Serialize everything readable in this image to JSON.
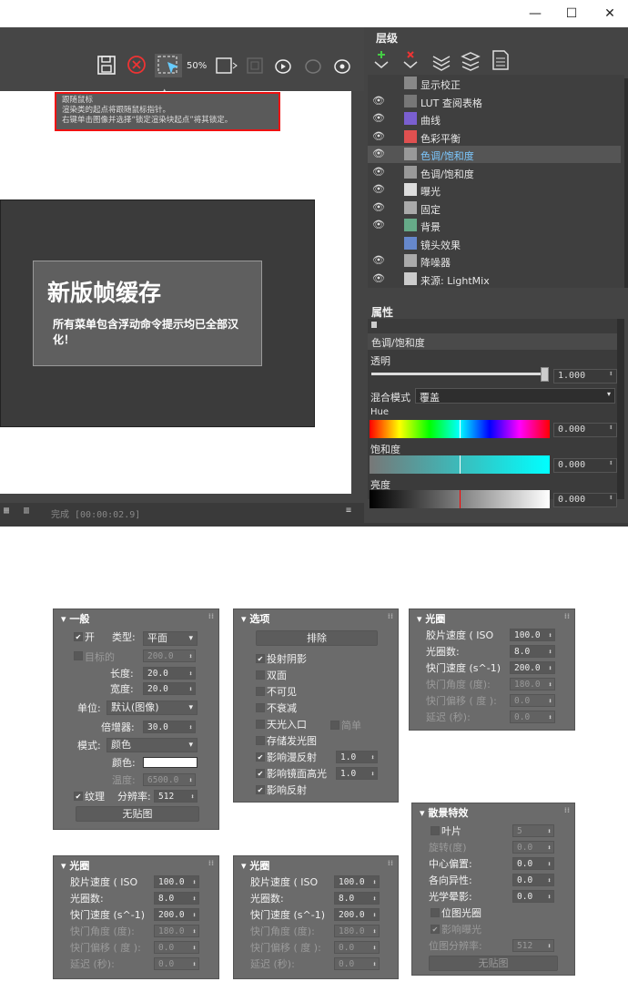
{
  "window": {
    "minimize": "—",
    "maximize": "☐",
    "close": "✕"
  },
  "viewer": {
    "zoom_label": "50%",
    "tooltip": {
      "line1": "跟随鼠标",
      "line2": "渲染类的起点将跟随鼠标指针。",
      "line3": "右键单击图像并选择“锁定渲染块起点”将其锁定。"
    },
    "card": {
      "title": "新版帧缓存",
      "desc": "所有菜单包含浮动命令提示均已全部汉化！"
    },
    "status": "完成 [00:00:02.9]"
  },
  "layers": {
    "title": "层级",
    "items": [
      {
        "label": "显示校正",
        "eye": false,
        "color": "#888"
      },
      {
        "label": "LUT 查阅表格",
        "eye": true,
        "color": "#777"
      },
      {
        "label": "曲线",
        "eye": true,
        "color": "#7a5fd0"
      },
      {
        "label": "色彩平衡",
        "eye": true,
        "color": "#e05050"
      },
      {
        "label": "色调/饱和度",
        "eye": true,
        "color": "#999",
        "selected": true
      },
      {
        "label": "色调/饱和度",
        "eye": true,
        "color": "#999"
      },
      {
        "label": "曝光",
        "eye": true,
        "color": "#ddd"
      },
      {
        "label": "固定",
        "eye": true,
        "color": "#aaa"
      },
      {
        "label": "背景",
        "eye": true,
        "color": "#6a8"
      },
      {
        "label": "镜头效果",
        "eye": false,
        "color": "#68c"
      },
      {
        "label": "降噪器",
        "eye": true,
        "color": "#aaa"
      },
      {
        "label": "来源: LightMix",
        "eye": true,
        "color": "#ccc"
      }
    ]
  },
  "properties": {
    "title": "属性",
    "layer_name": "色调/饱和度",
    "opacity_label": "透明",
    "opacity_value": "1.000",
    "opacity": 1.0,
    "blend_label": "混合模式",
    "blend_value": "覆盖",
    "hue_label": "Hue",
    "hue_value": "0.000",
    "sat_label": "饱和度",
    "sat_value": "0.000",
    "light_label": "亮度",
    "light_value": "0.000"
  },
  "panel_general": {
    "title": "一般",
    "on_label": "开",
    "type_label": "类型:",
    "type_value": "平面",
    "targeted_label": "目标的",
    "targeted_value": "200.0",
    "length_label": "长度:",
    "length_value": "20.0",
    "width_label": "宽度:",
    "width_value": "20.0",
    "unit_label": "单位:",
    "unit_value": "默认(图像)",
    "mult_label": "倍增器:",
    "mult_value": "30.0",
    "mode_label": "模式:",
    "mode_value": "颜色",
    "color_label": "颜色:",
    "temp_label": "温度:",
    "temp_value": "6500.0",
    "texture_label": "纹理",
    "res_label": "分辨率:",
    "res_value": "512",
    "nomap_button": "无贴图"
  },
  "panel_options": {
    "title": "选项",
    "exclude_button": "排除",
    "items": [
      {
        "label": "投射阴影",
        "checked": true
      },
      {
        "label": "双面",
        "checked": false
      },
      {
        "label": "不可见",
        "checked": false
      },
      {
        "label": "不衰减",
        "checked": false
      },
      {
        "label": "天光入口",
        "checked": false
      },
      {
        "label": "存储发光图",
        "checked": false
      },
      {
        "label": "影响漫反射",
        "checked": true
      },
      {
        "label": "影响镜面高光",
        "checked": true
      },
      {
        "label": "影响反射",
        "checked": true
      }
    ],
    "simple_label": "简单",
    "diffuse_value": "1.0",
    "specular_value": "1.0"
  },
  "panel_aperture": {
    "title": "光圈",
    "film_label": "胶片速度 ( ISO",
    "film_value": "100.0",
    "fnum_label": "光圈数:",
    "fnum_value": "8.0",
    "shutter_label": "快门速度 (s^-1)",
    "shutter_value": "200.0",
    "angle_label": "快门角度 (度):",
    "angle_value": "180.0",
    "offset_label": "快门偏移 ( 度 ):",
    "offset_value": "0.0",
    "latency_label": "延迟 (秒):",
    "latency_value": "0.0"
  },
  "panel_bokeh": {
    "title": "散景特效",
    "blades_label": "叶片",
    "blades_value": "5",
    "rotation_label": "旋转(度)",
    "rotation_value": "0.0",
    "center_label": "中心偏置:",
    "center_value": "0.0",
    "aniso_label": "各向异性:",
    "aniso_value": "0.0",
    "vignette_label": "光学晕影:",
    "vignette_value": "0.0",
    "bitmap_label": "位图光圈",
    "affect_label": "影响曝光",
    "bitres_label": "位图分辨率:",
    "bitres_value": "512",
    "nomap_button": "无贴图"
  }
}
